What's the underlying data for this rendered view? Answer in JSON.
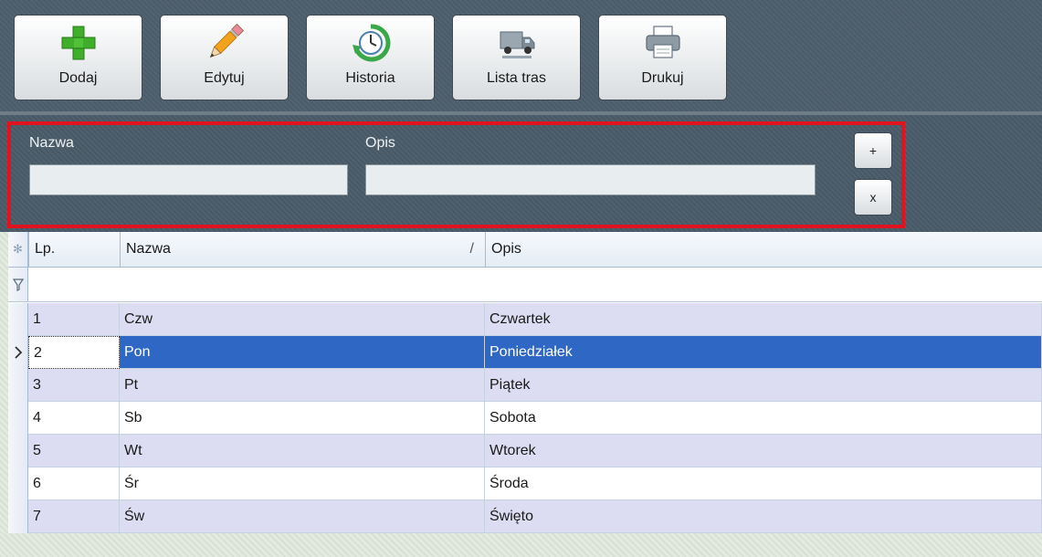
{
  "toolbar": {
    "buttons": [
      {
        "label": "Dodaj",
        "icon": "plus-icon"
      },
      {
        "label": "Edytuj",
        "icon": "pencil-icon"
      },
      {
        "label": "Historia",
        "icon": "history-clock-icon"
      },
      {
        "label": "Lista tras",
        "icon": "truck-icon"
      },
      {
        "label": "Drukuj",
        "icon": "printer-icon"
      }
    ]
  },
  "filter": {
    "name_label": "Nazwa",
    "name_value": "",
    "desc_label": "Opis",
    "desc_value": "",
    "add_label": "+",
    "clear_label": "x",
    "highlight_color": "#e0141e"
  },
  "grid": {
    "columns": [
      {
        "label": "Lp.",
        "sort": ""
      },
      {
        "label": "Nazwa",
        "sort": "/"
      },
      {
        "label": "Opis",
        "sort": ""
      }
    ],
    "rows": [
      {
        "lp": "1",
        "nazwa": "Czw",
        "opis": "Czwartek"
      },
      {
        "lp": "2",
        "nazwa": "Pon",
        "opis": "Poniedziałek"
      },
      {
        "lp": "3",
        "nazwa": "Pt",
        "opis": "Piątek"
      },
      {
        "lp": "4",
        "nazwa": "Sb",
        "opis": "Sobota"
      },
      {
        "lp": "5",
        "nazwa": "Wt",
        "opis": "Wtorek"
      },
      {
        "lp": "6",
        "nazwa": "Śr",
        "opis": "Środa"
      },
      {
        "lp": "7",
        "nazwa": "Św",
        "opis": "Święto"
      }
    ],
    "selected_row": 1,
    "selection_color": "#2f68c4",
    "alt_row_color": "#dcdcf2"
  }
}
